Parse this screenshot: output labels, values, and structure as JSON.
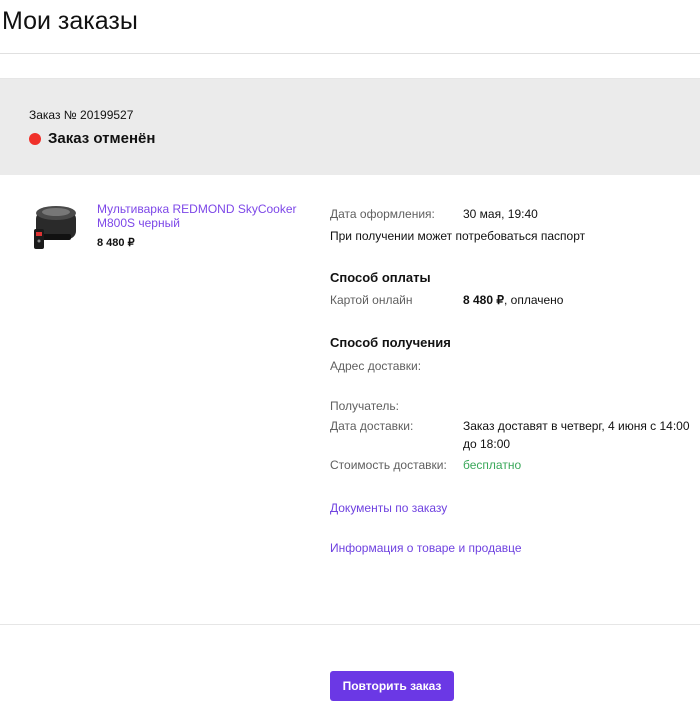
{
  "page": {
    "title": "Мои заказы"
  },
  "order": {
    "number_label": "Заказ № 20199527",
    "status": "Заказ отменён",
    "status_color": "#f0302a",
    "product": {
      "name": "Мультиварка REDMOND SkyCooker M800S черный",
      "price": "8 480 ₽"
    },
    "details": {
      "order_date_label": "Дата оформления:",
      "order_date_value": "30 мая, 19:40",
      "passport_note": "При получении может потребоваться паспорт",
      "payment_title": "Способ оплаты",
      "payment_method": "Картой онлайн",
      "payment_amount": "8 480 ₽",
      "payment_status": ", оплачено",
      "delivery_title": "Способ получения",
      "address_label": "Адрес доставки:",
      "recipient_label": "Получатель:",
      "delivery_date_label": "Дата доставки:",
      "delivery_date_value": "Заказ доставят в четверг, 4 июня с 14:00 до 18:00",
      "delivery_cost_label": "Стоимость доставки:",
      "delivery_cost_value": "бесплатно"
    },
    "links": {
      "documents": "Документы по заказу",
      "product_info": "Информация о товаре и продавце"
    },
    "repeat_button": "Повторить заказ"
  },
  "colors": {
    "accent": "#6b38e5",
    "link": "#6f42e0",
    "free": "#3aa85a",
    "header_bg": "#ebebeb"
  }
}
